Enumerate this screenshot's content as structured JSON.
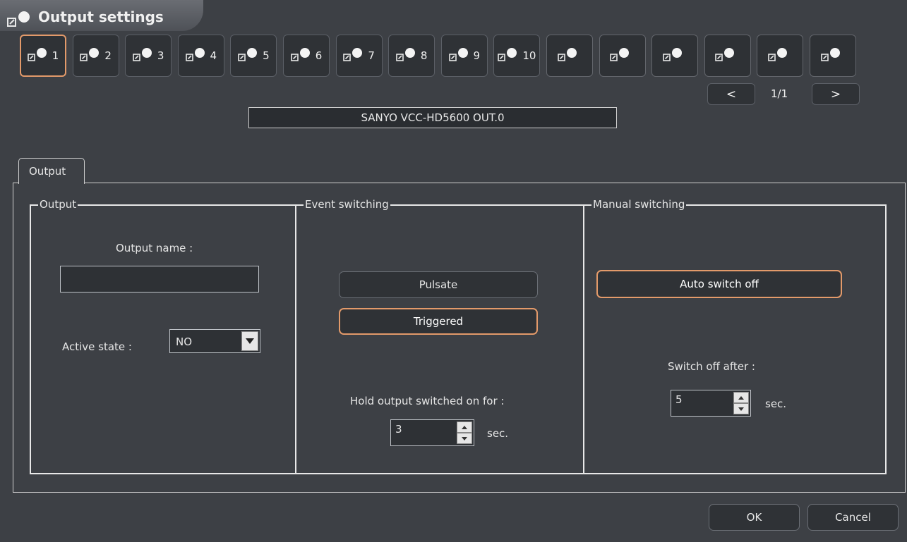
{
  "window": {
    "title": "Output settings",
    "title_icon": "output-icon"
  },
  "outputs": {
    "buttons": [
      {
        "label": "1",
        "icon": "output-icon",
        "selected": true
      },
      {
        "label": "2",
        "icon": "output-icon"
      },
      {
        "label": "3",
        "icon": "output-icon"
      },
      {
        "label": "4",
        "icon": "output-icon"
      },
      {
        "label": "5",
        "icon": "output-icon"
      },
      {
        "label": "6",
        "icon": "output-icon"
      },
      {
        "label": "7",
        "icon": "output-icon"
      },
      {
        "label": "8",
        "icon": "output-icon"
      },
      {
        "label": "9",
        "icon": "output-icon"
      },
      {
        "label": "10",
        "icon": "output-icon"
      },
      {
        "label": "",
        "icon": "output-icon"
      },
      {
        "label": "",
        "icon": "output-icon"
      },
      {
        "label": "",
        "icon": "output-icon"
      },
      {
        "label": "",
        "icon": "output-icon"
      },
      {
        "label": "",
        "icon": "output-icon"
      },
      {
        "label": "",
        "icon": "output-icon"
      }
    ],
    "pager": {
      "prev": "<",
      "next": ">",
      "indicator": "1/1"
    },
    "camera_name": "SANYO VCC-HD5600  OUT.0"
  },
  "tabs": [
    {
      "label": "Output"
    }
  ],
  "groups": {
    "output": {
      "legend": "Output",
      "name_label": "Output name :",
      "name_value": "",
      "active_state_label": "Active state :",
      "active_state_value": "NO"
    },
    "event": {
      "legend": "Event switching",
      "pulsate_label": "Pulsate",
      "triggered_label": "Triggered",
      "hold_label": "Hold output switched on for :",
      "hold_value": "3",
      "unit": "sec."
    },
    "manual": {
      "legend": "Manual switching",
      "auto_label": "Auto switch off",
      "switch_off_label": "Switch off after :",
      "switch_off_value": "5",
      "unit": "sec."
    }
  },
  "footer": {
    "ok_label": "OK",
    "cancel_label": "Cancel"
  },
  "colors": {
    "background": "#3d4045",
    "accent": "#e39a6a",
    "button": "#2f3236"
  }
}
